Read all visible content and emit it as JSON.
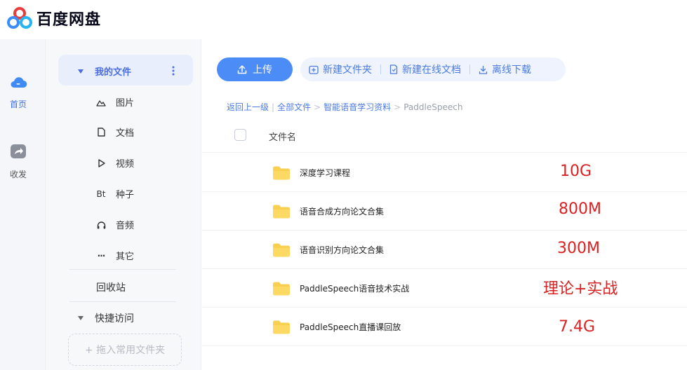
{
  "app": {
    "title": "百度网盘"
  },
  "rail": {
    "items": [
      {
        "label": "首页",
        "icon": "cloud-home-icon",
        "active": true
      },
      {
        "label": "收发",
        "icon": "share-transfer-icon",
        "active": false
      }
    ]
  },
  "sidebar": {
    "my_files": "我的文件",
    "more_icon": "vertical-dots-icon",
    "categories": [
      {
        "label": "图片",
        "icon": "image-icon"
      },
      {
        "label": "文档",
        "icon": "document-icon"
      },
      {
        "label": "视频",
        "icon": "play-icon"
      },
      {
        "label": "种子",
        "icon": "bt",
        "glyph": "Bt"
      },
      {
        "label": "音频",
        "icon": "headphones-icon"
      },
      {
        "label": "其它",
        "icon": "ellipsis-icon",
        "glyph": "···"
      }
    ],
    "recycle": "回收站",
    "quick_access": "快捷访问",
    "drop_hint": "+ 拖入常用文件夹"
  },
  "toolbar": {
    "upload": "上传",
    "new_folder": "新建文件夹",
    "new_doc": "新建在线文档",
    "offline_download": "离线下载"
  },
  "breadcrumb": {
    "back": "返回上一级",
    "items": [
      "全部文件",
      "智能语音学习资料"
    ],
    "current": "PaddleSpeech"
  },
  "table": {
    "column_name": "文件名",
    "rows": [
      {
        "name": "深度学习课程",
        "note": "10G"
      },
      {
        "name": "语音合成方向论文合集",
        "note": "800M"
      },
      {
        "name": "语音识别方向论文合集",
        "note": "300M"
      },
      {
        "name": "PaddleSpeech语音技术实战",
        "note": "理论+实战"
      },
      {
        "name": "PaddleSpeech直播课回放",
        "note": "7.4G"
      }
    ]
  },
  "colors": {
    "accent": "#4b8cf6",
    "accent_text": "#4b7bdf",
    "note_red": "#d92121",
    "folder_yellow": "#f8cf4e"
  }
}
